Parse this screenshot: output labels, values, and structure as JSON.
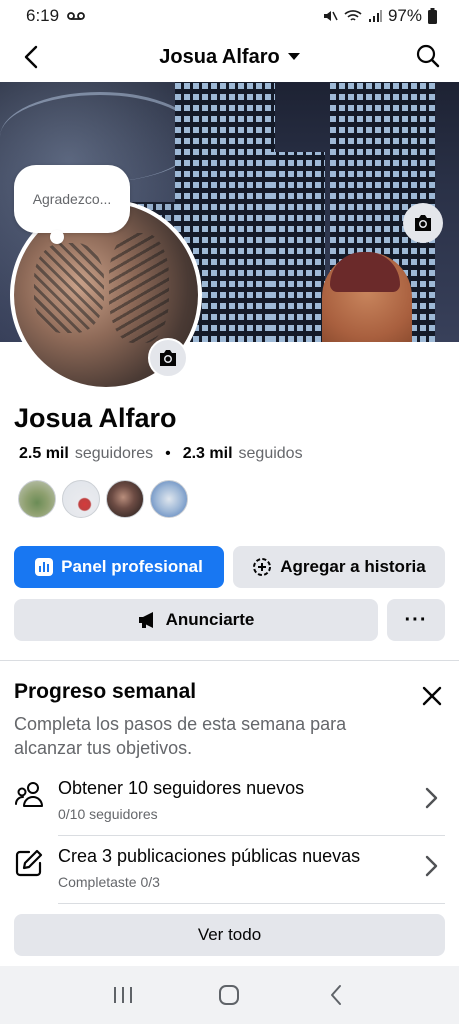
{
  "status_bar": {
    "time": "6:19",
    "battery": "97%"
  },
  "header": {
    "title": "Josua Alfaro"
  },
  "note": {
    "text": "Agradezco..."
  },
  "profile": {
    "name": "Josua Alfaro",
    "followers_count": "2.5 mil",
    "followers_label": "seguidores",
    "separator": "•",
    "following_count": "2.3 mil",
    "following_label": "seguidos"
  },
  "actions": {
    "dashboard_label": "Panel profesional",
    "story_label": "Agregar a historia",
    "ads_label": "Anunciarte",
    "more_label": "···"
  },
  "progress": {
    "title": "Progreso semanal",
    "subtitle": "Completa los pasos de esta semana para alcanzar tus objetivos.",
    "tasks": [
      {
        "title": "Obtener 10 seguidores nuevos",
        "subtitle": "0/10 seguidores",
        "icon": "people-icon"
      },
      {
        "title": "Crea 3 publicaciones públicas nuevas",
        "subtitle": "Completaste 0/3",
        "icon": "compose-icon"
      }
    ],
    "see_all_label": "Ver todo"
  },
  "colors": {
    "primary": "#1877f2",
    "secondary_button": "#e4e6eb",
    "muted_text": "#65676b"
  }
}
